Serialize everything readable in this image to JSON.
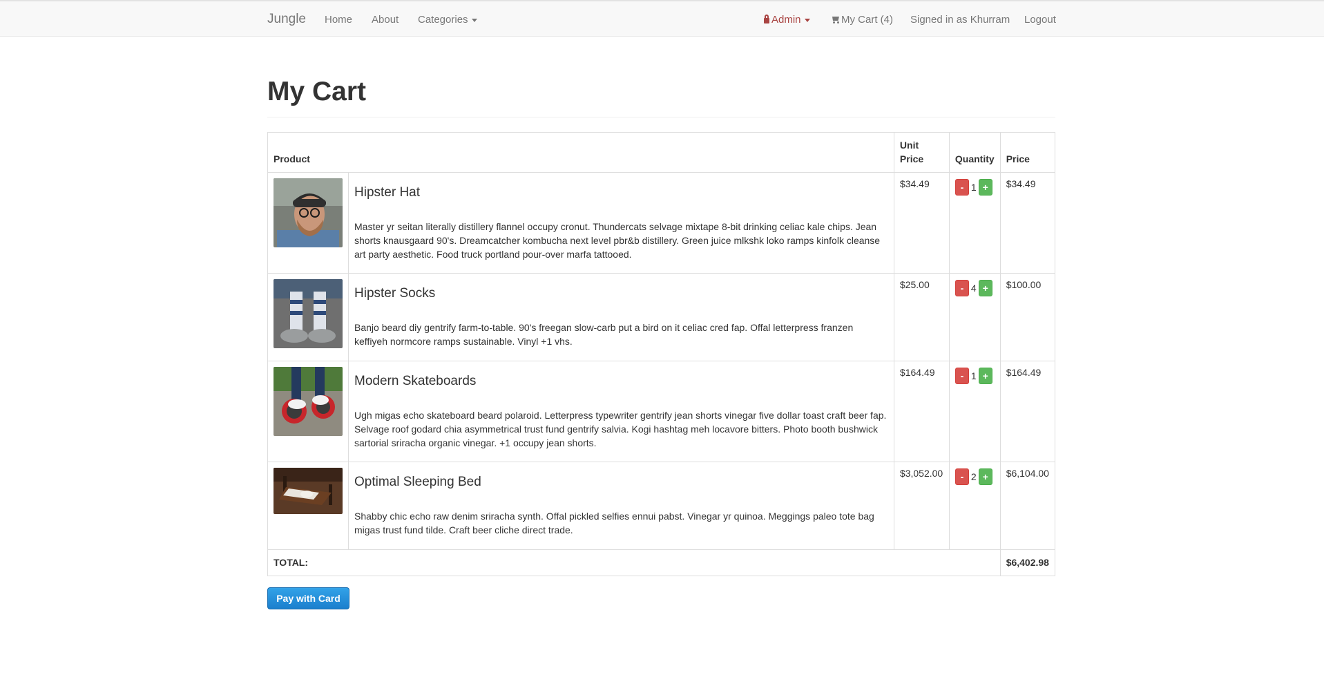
{
  "navbar": {
    "brand": "Jungle",
    "links": {
      "home": "Home",
      "about": "About",
      "categories": "Categories"
    },
    "admin": "Admin",
    "cart": "My Cart (4)",
    "signed_in": "Signed in as Khurram",
    "logout": "Logout"
  },
  "page": {
    "title": "My Cart"
  },
  "table": {
    "headers": {
      "product": "Product",
      "unit_price": "Unit Price",
      "quantity": "Quantity",
      "price": "Price"
    },
    "items": [
      {
        "name": "Hipster Hat",
        "description": "Master yr seitan literally distillery flannel occupy cronut. Thundercats selvage mixtape 8-bit drinking celiac kale chips. Jean shorts knausgaard 90's. Dreamcatcher kombucha next level pbr&b distillery. Green juice mlkshk loko ramps kinfolk cleanse art party aesthetic. Food truck portland pour-over marfa tattooed.",
        "unit_price": "$34.49",
        "quantity": "1",
        "price": "$34.49",
        "image_icon": "hipster-man-photo"
      },
      {
        "name": "Hipster Socks",
        "description": "Banjo beard diy gentrify farm-to-table. 90's freegan slow-carb put a bird on it celiac cred fap. Offal letterpress franzen keffiyeh normcore ramps sustainable. Vinyl +1 vhs.",
        "unit_price": "$25.00",
        "quantity": "4",
        "price": "$100.00",
        "image_icon": "socks-photo"
      },
      {
        "name": "Modern Skateboards",
        "description": "Ugh migas echo skateboard beard polaroid. Letterpress typewriter gentrify jean shorts vinegar five dollar toast craft beer fap. Selvage roof godard chia asymmetrical trust fund gentrify salvia. Kogi hashtag meh locavore bitters. Photo booth bushwick sartorial sriracha organic vinegar. +1 occupy jean shorts.",
        "unit_price": "$164.49",
        "quantity": "1",
        "price": "$164.49",
        "image_icon": "skates-photo"
      },
      {
        "name": "Optimal Sleeping Bed",
        "description": "Shabby chic echo raw denim sriracha synth. Offal pickled selfies ennui pabst. Vinegar yr quinoa. Meggings paleo tote bag migas trust fund tilde. Craft beer cliche direct trade.",
        "unit_price": "$3,052.00",
        "quantity": "2",
        "price": "$6,104.00",
        "image_icon": "bed-photo"
      }
    ],
    "minus_label": "-",
    "plus_label": "+",
    "total_label": "TOTAL:",
    "total_value": "$6,402.98"
  },
  "checkout": {
    "pay_label": "Pay with Card"
  },
  "colors": {
    "admin_red": "#a94442",
    "minus_red": "#d9534f",
    "plus_green": "#5cb85c",
    "pay_blue": "#1b7fcd"
  }
}
